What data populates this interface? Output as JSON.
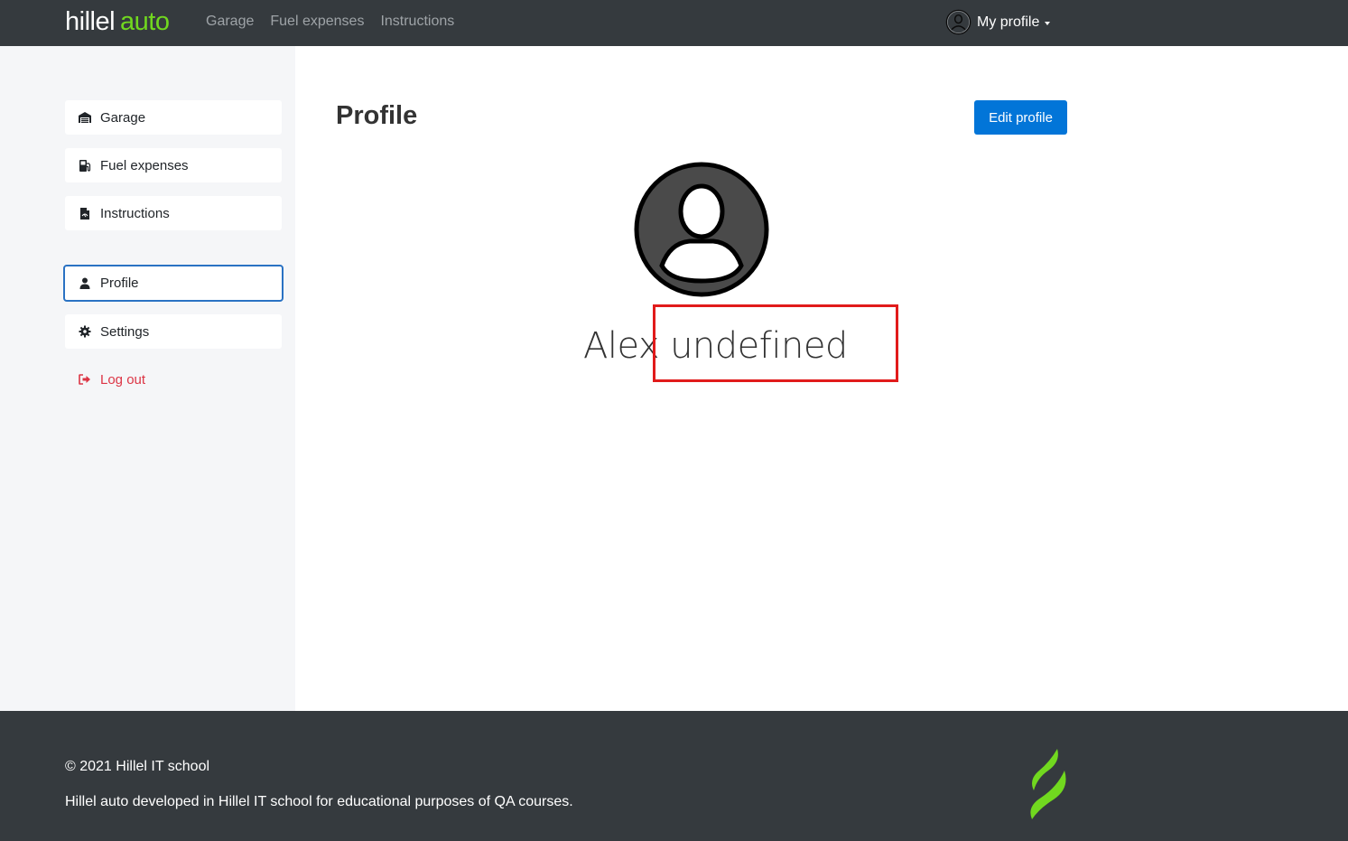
{
  "header": {
    "logo_main": "hillel",
    "logo_accent": "auto",
    "nav": [
      "Garage",
      "Fuel expenses",
      "Instructions"
    ],
    "profile_label": "My profile"
  },
  "sidebar": {
    "items": [
      {
        "label": "Garage",
        "icon": "garage-icon"
      },
      {
        "label": "Fuel expenses",
        "icon": "fuel-icon"
      },
      {
        "label": "Instructions",
        "icon": "pdf-file-icon"
      },
      {
        "label": "Profile",
        "icon": "user-icon",
        "active": true
      },
      {
        "label": "Settings",
        "icon": "gear-icon"
      }
    ],
    "logout": {
      "label": "Log out",
      "icon": "sign-out-icon"
    }
  },
  "main": {
    "title": "Profile",
    "edit_button": "Edit profile",
    "first_name": "Alex",
    "last_name": "undefined"
  },
  "footer": {
    "copyright": "© 2021 Hillel IT school",
    "description": "Hillel auto developed in Hillel IT school for educational purposes of QA courses."
  },
  "colors": {
    "header_bg": "#353a3e",
    "accent_green": "#71d81f",
    "primary_blue": "#0275d8",
    "danger_red": "#dc3545",
    "active_border": "#2a72c3",
    "annotation_red": "#e11b1b"
  }
}
